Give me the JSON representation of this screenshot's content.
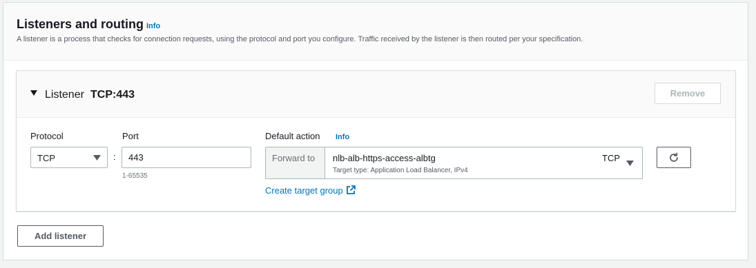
{
  "section": {
    "title": "Listeners and routing",
    "info_label": "Info",
    "description": "A listener is a process that checks for connection requests, using the protocol and port you configure. Traffic received by the listener is then routed per your specification."
  },
  "listener": {
    "heading": "Listener",
    "name": "TCP:443",
    "remove_label": "Remove",
    "protocol_label": "Protocol",
    "protocol_value": "TCP",
    "port_label": "Port",
    "port_value": "443",
    "port_hint": "1-65535",
    "default_action_label": "Default action",
    "default_action_info": "Info",
    "forward_addon": "Forward to",
    "target_group_name": "nlb-alb-https-access-albtg",
    "target_group_meta": "Target type: Application Load Balancer, IPv4",
    "target_group_protocol": "TCP",
    "create_target_group_label": "Create target group"
  },
  "add_listener_label": "Add listener",
  "colors": {
    "link": "#0073bb",
    "border": "#aab7b8",
    "disabled_text": "#aab7b8",
    "header_bg": "#fafafa"
  },
  "icons": {
    "expand": "caret-down-icon",
    "dropdown": "chevron-down-icon",
    "refresh": "refresh-icon",
    "external": "external-link-icon"
  }
}
